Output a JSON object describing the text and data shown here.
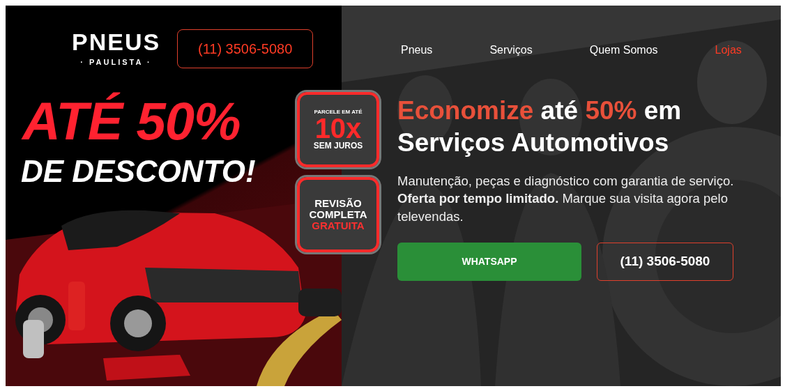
{
  "banner": {
    "logo": {
      "name": "PNEUS",
      "tagline": "· PAULISTA ·"
    },
    "phone": "(11) 3506-5080",
    "headline": "ATÉ 50%",
    "subline": "DE DESCONTO!",
    "badges": [
      {
        "kind": "installments",
        "lines": [
          "PARCELE EM ATÉ",
          "10x",
          "SEM JUROS"
        ]
      },
      {
        "kind": "review",
        "lines": [
          "REVISÃO",
          "COMPLETA",
          "GRATUITA"
        ]
      }
    ]
  },
  "nav": [
    {
      "label": "Pneus",
      "selected": false
    },
    {
      "label": "Serviços",
      "selected": false
    },
    {
      "label": "Quem Somos",
      "selected": false
    },
    {
      "label": "Lojas",
      "selected": true
    }
  ],
  "hero": {
    "heading": [
      [
        {
          "text": "Economize",
          "accent": true
        },
        {
          "text": " até ",
          "accent": false
        },
        {
          "text": "50%",
          "accent": true
        },
        {
          "text": " em",
          "accent": false
        }
      ],
      [
        {
          "text": "Serviços Automotivos",
          "accent": false
        }
      ]
    ],
    "text": "Manutenção, peças e diagnóstico com garantia de serviço. **Oferta por tempo limitado.** Marque sua visita agora pelo televendas.",
    "buttons": [
      {
        "kind": "whatsapp",
        "label": "WHATSAPP"
      },
      {
        "kind": "phone",
        "label": "(11) 3506-5080"
      }
    ]
  }
}
